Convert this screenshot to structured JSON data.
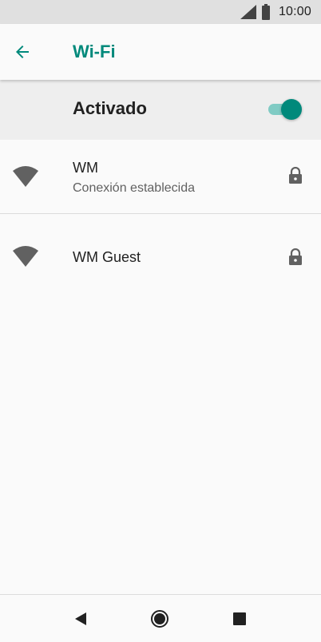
{
  "status_bar": {
    "time": "10:00",
    "icons": [
      "signal-icon",
      "battery-icon"
    ]
  },
  "app_bar": {
    "title": "Wi-Fi",
    "back_icon": "arrow-left-icon"
  },
  "master_switch": {
    "label": "Activado",
    "state": "on"
  },
  "networks": [
    {
      "name": "WM",
      "status": "Conexión establecida",
      "icon": "wifi-icon",
      "secured": true
    },
    {
      "name": "WM Guest",
      "status": "",
      "icon": "wifi-icon",
      "secured": true
    }
  ],
  "nav_bar": {
    "buttons": [
      "back-triangle-icon",
      "home-circle-icon",
      "recents-square-icon"
    ]
  },
  "colors": {
    "accent": "#00897b",
    "accent_light": "#80cbc4",
    "status_bar_bg": "#e0e0e0",
    "master_row_bg": "#eeeeee",
    "icon_gray": "#616161"
  }
}
